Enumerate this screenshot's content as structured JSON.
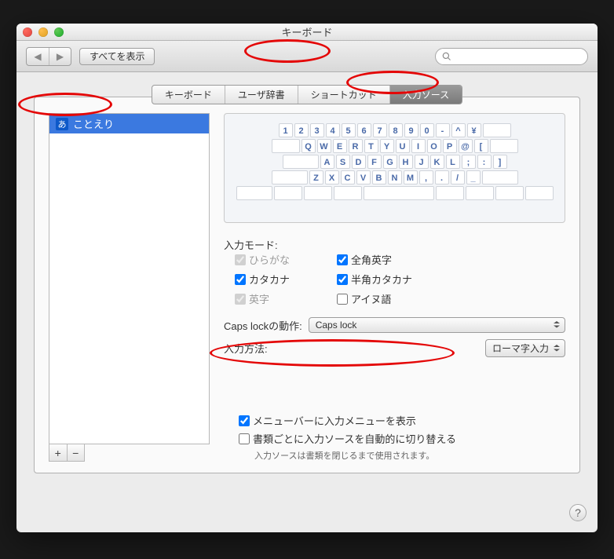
{
  "window": {
    "title": "キーボード"
  },
  "toolbar": {
    "show_all": "すべてを表示",
    "search_placeholder": ""
  },
  "tabs": [
    {
      "label": "キーボード",
      "selected": false
    },
    {
      "label": "ユーザ辞書",
      "selected": false
    },
    {
      "label": "ショートカット",
      "selected": false
    },
    {
      "label": "入力ソース",
      "selected": true
    }
  ],
  "sidebar": {
    "items": [
      {
        "icon": "あ",
        "label": "ことえり"
      }
    ]
  },
  "input_mode": {
    "label": "入力モード:",
    "options": [
      {
        "label": "ひらがな",
        "checked": true,
        "disabled": true
      },
      {
        "label": "全角英字",
        "checked": true,
        "disabled": false
      },
      {
        "label": "カタカナ",
        "checked": true,
        "disabled": false
      },
      {
        "label": "半角カタカナ",
        "checked": true,
        "disabled": false
      },
      {
        "label": "英字",
        "checked": true,
        "disabled": true
      },
      {
        "label": "アイヌ語",
        "checked": false,
        "disabled": false
      }
    ]
  },
  "caps_lock": {
    "label": "Caps lockの動作:",
    "value": "Caps lock"
  },
  "input_method": {
    "label": "入力方法:",
    "value": "ローマ字入力"
  },
  "footer": {
    "show_menu": {
      "label": "メニューバーに入力メニューを表示",
      "checked": true
    },
    "auto_switch": {
      "label": "書類ごとに入力ソースを自動的に切り替える",
      "checked": false
    },
    "note": "入力ソースは書類を閉じるまで使用されます。"
  },
  "keyboard_rows": [
    [
      "1",
      "2",
      "3",
      "4",
      "5",
      "6",
      "7",
      "8",
      "9",
      "0",
      "-",
      "^",
      "¥"
    ],
    [
      "Q",
      "W",
      "E",
      "R",
      "T",
      "Y",
      "U",
      "I",
      "O",
      "P",
      "@",
      "["
    ],
    [
      "A",
      "S",
      "D",
      "F",
      "G",
      "H",
      "J",
      "K",
      "L",
      ";",
      ":",
      "]"
    ],
    [
      "Z",
      "X",
      "C",
      "V",
      "B",
      "N",
      "M",
      ",",
      ".",
      "/",
      "_"
    ]
  ]
}
